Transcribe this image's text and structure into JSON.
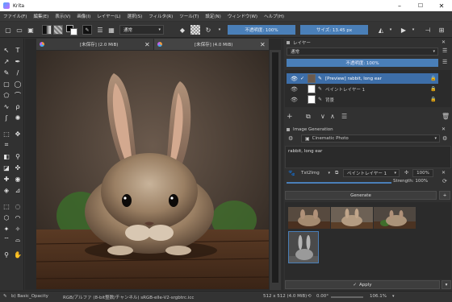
{
  "window": {
    "title": "Krita",
    "minimize": "–",
    "maximize": "☐",
    "close": "✕"
  },
  "menu": [
    "ファイル(F)",
    "編集(E)",
    "表示(V)",
    "画像(I)",
    "レイヤー(L)",
    "選択(S)",
    "フィルタ(R)",
    "ツール(T)",
    "設定(N)",
    "ウィンドウ(W)",
    "ヘルプ(H)"
  ],
  "toolbar": {
    "blend_mode": "通常",
    "opacity": "不透明度: 100%",
    "size": "サイズ: 13.45 px"
  },
  "tabs": [
    {
      "label": "[未保存] (2.0 MiB)"
    },
    {
      "label": "[未保存] (4.0 MiB)"
    }
  ],
  "layers_panel": {
    "title": "レイヤー",
    "blend_mode": "通常",
    "opacity": "不透明度: 100%",
    "layers": [
      {
        "name": "[Preview] rabbit, long ear",
        "selected": true
      },
      {
        "name": "ペイントレイヤー 1",
        "selected": false
      },
      {
        "name": "背景",
        "selected": false
      }
    ]
  },
  "image_generation": {
    "title": "Image Generation",
    "style": "Cinematic Photo",
    "prompt": "rabbit, long ear",
    "mode": "Txt2Img",
    "layer": "ペイントレイヤー 1",
    "strength_value": "100%",
    "strength_label": "Strength: 100%",
    "generate_label": "Generate",
    "apply_label": "Apply"
  },
  "status": {
    "brush": "b) Basic_Opacity",
    "color_space": "RGB/アルファ (8-bit整数/チャンネル) sRGB-elle-V2-srgbtrc.icc",
    "image_size": "512 x 512 (4.0 MiB)",
    "rotation": "0.00°",
    "zoom": "106.1%"
  },
  "colors": {
    "accent": "#4a7fb8",
    "selection": "#3d6ea8",
    "panel": "#313131",
    "canvas": "#2a2a2a"
  }
}
